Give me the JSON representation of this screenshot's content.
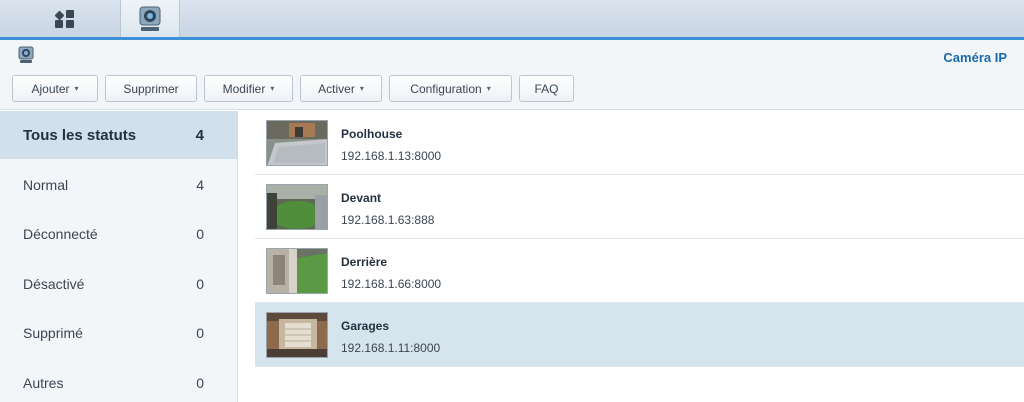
{
  "header": {
    "title": "Caméra IP"
  },
  "toolbar": {
    "buttons": [
      {
        "label": "Ajouter",
        "caret": "▾"
      },
      {
        "label": "Supprimer"
      },
      {
        "label": "Modifier",
        "caret": "▾"
      },
      {
        "label": "Activer",
        "caret": "▾"
      },
      {
        "label": "Configuration",
        "caret": "▾"
      },
      {
        "label": "FAQ"
      }
    ]
  },
  "sidebar": {
    "items": [
      {
        "label": "Tous les statuts",
        "count": "4",
        "active": true
      },
      {
        "label": "Normal",
        "count": "4"
      },
      {
        "label": "Déconnecté",
        "count": "0"
      },
      {
        "label": "Désactivé",
        "count": "0"
      },
      {
        "label": "Supprimé",
        "count": "0"
      },
      {
        "label": "Autres",
        "count": "0"
      }
    ]
  },
  "cameras": [
    {
      "name": "Poolhouse",
      "address": "192.168.1.13:8000",
      "thumbnail": "pool-scene"
    },
    {
      "name": "Devant",
      "address": "192.168.1.63:888",
      "thumbnail": "lawn-scene"
    },
    {
      "name": "Derrière",
      "address": "192.168.1.66:8000",
      "thumbnail": "backyard-scene"
    },
    {
      "name": "Garages",
      "address": "192.168.1.11:8000",
      "thumbnail": "garage-scene",
      "selected": true
    }
  ],
  "colors": {
    "accent": "#3d8fd6",
    "title": "#1a6aae",
    "selection": "#d6e4ee"
  }
}
